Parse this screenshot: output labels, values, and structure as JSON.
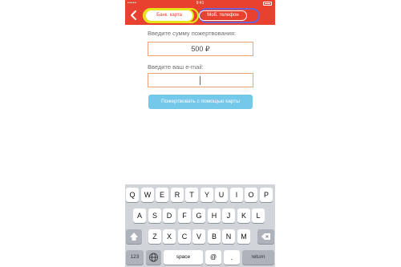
{
  "status": {
    "carrier": "•••••",
    "time": "9:41"
  },
  "header": {
    "tabs": [
      {
        "label": "Банк. карта"
      },
      {
        "label": "Моб. телефон"
      }
    ]
  },
  "form": {
    "amount_label": "Введите сумму пожертвования:",
    "amount_value": "500 ₽",
    "email_label": "Введите ваш e-mail:",
    "email_value": "",
    "submit_label": "Пожертвовать с помощью карты"
  },
  "keyboard": {
    "row1": [
      "Q",
      "W",
      "E",
      "R",
      "T",
      "Y",
      "U",
      "I",
      "O",
      "P"
    ],
    "row2": [
      "A",
      "S",
      "D",
      "F",
      "G",
      "H",
      "J",
      "K",
      "L"
    ],
    "row3": [
      "Z",
      "X",
      "C",
      "V",
      "B",
      "N",
      "M"
    ],
    "numbers_key": "123",
    "space_key": "space",
    "at_key": "@",
    "dot_key": ".",
    "return_key": "return"
  },
  "colors": {
    "header": "#e8412f",
    "button": "#74c8ea",
    "field_border": "#f0a07a",
    "highlight_yellow": "#e6e51c",
    "highlight_blue": "#6b63d6"
  }
}
